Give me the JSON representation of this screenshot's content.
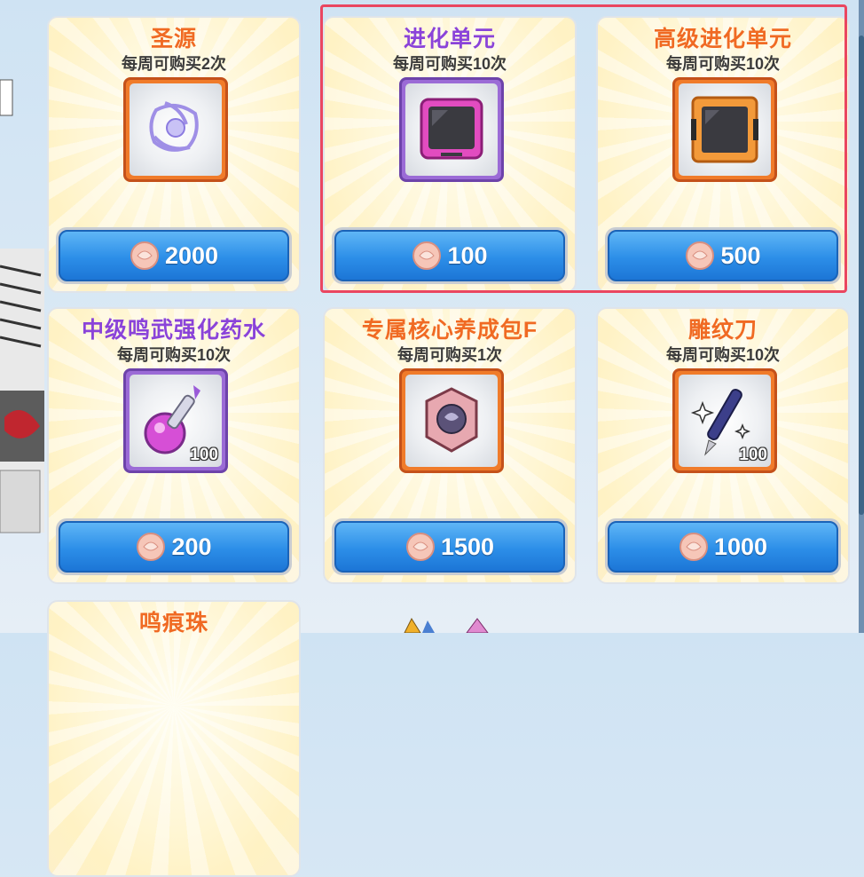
{
  "shop": {
    "items": [
      {
        "name": "圣源",
        "limit": "每周可购买2次",
        "price": "2000",
        "qty": "",
        "name_color": "orange",
        "frame": "orange",
        "icon": "holy-source-icon"
      },
      {
        "name": "进化单元",
        "limit": "每周可购买10次",
        "price": "100",
        "qty": "",
        "name_color": "purple",
        "frame": "purple",
        "icon": "evolution-unit-icon"
      },
      {
        "name": "高级进化单元",
        "limit": "每周可购买10次",
        "price": "500",
        "qty": "",
        "name_color": "orange",
        "frame": "orange",
        "icon": "advanced-evolution-unit-icon"
      },
      {
        "name": "中级鸣武强化药水",
        "limit": "每周可购买10次",
        "price": "200",
        "qty": "100",
        "name_color": "purple",
        "frame": "purple",
        "icon": "potion-icon"
      },
      {
        "name": "专属核心养成包F",
        "limit": "每周可购买1次",
        "price": "1500",
        "qty": "",
        "name_color": "orange",
        "frame": "orange",
        "icon": "core-pack-icon"
      },
      {
        "name": "雕纹刀",
        "limit": "每周可购买10次",
        "price": "1000",
        "qty": "100",
        "name_color": "orange",
        "frame": "orange",
        "icon": "carving-knife-icon"
      },
      {
        "name": "鸣痕珠",
        "limit": "",
        "price": "",
        "qty": "",
        "name_color": "orange",
        "frame": "orange",
        "icon": ""
      }
    ]
  },
  "colors": {
    "highlight_border": "#ea4660",
    "name_orange": "#f06a23",
    "name_purple": "#8a43d9",
    "button_blue": "#2c8ee8"
  },
  "currency_icon": "shell-coin-icon"
}
